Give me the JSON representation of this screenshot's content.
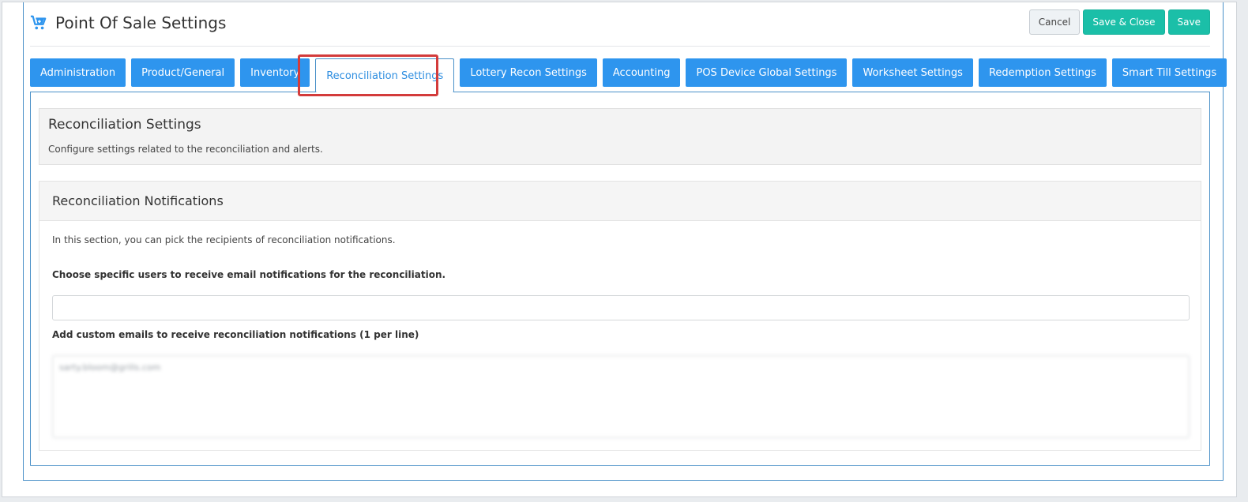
{
  "header": {
    "title": "Point Of Sale Settings",
    "icon": "cart-plus-icon",
    "cancel_label": "Cancel",
    "save_close_label": "Save & Close",
    "save_label": "Save"
  },
  "tabs": [
    {
      "label": "Administration",
      "active": false
    },
    {
      "label": "Product/General",
      "active": false
    },
    {
      "label": "Inventory",
      "active": false
    },
    {
      "label": "Reconciliation Settings",
      "active": true
    },
    {
      "label": "Lottery Recon Settings",
      "active": false
    },
    {
      "label": "Accounting",
      "active": false
    },
    {
      "label": "POS Device Global Settings",
      "active": false
    },
    {
      "label": "Worksheet Settings",
      "active": false
    },
    {
      "label": "Redemption Settings",
      "active": false
    },
    {
      "label": "Smart Till Settings",
      "active": false
    }
  ],
  "intro": {
    "title": "Reconciliation Settings",
    "description": "Configure settings related to the reconciliation and alerts."
  },
  "notifications": {
    "heading": "Reconciliation Notifications",
    "description": "In this section, you can pick the recipients of reconciliation notifications.",
    "users_label": "Choose specific users to receive email notifications for the reconciliation.",
    "users_value": "",
    "emails_label": "Add custom emails to receive reconciliation notifications (1 per line)",
    "emails_value": "sarty.bloom@grills.com"
  },
  "colors": {
    "tab_blue": "#2e95ee",
    "teal": "#1bbfa8",
    "highlight_red": "#d33b3b",
    "panel_border": "#4a90c8"
  }
}
